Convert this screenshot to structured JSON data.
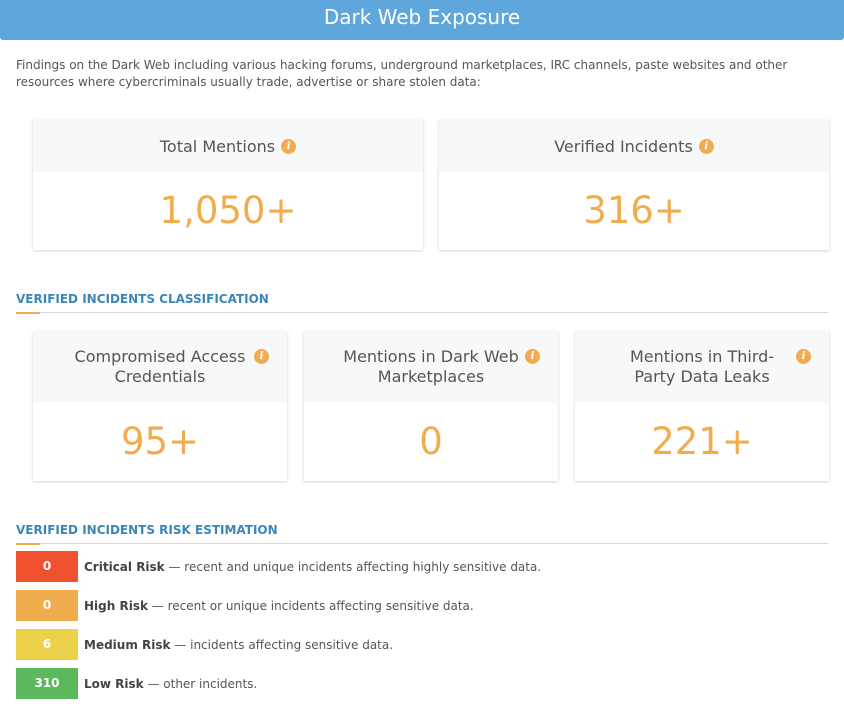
{
  "header": {
    "title": "Dark Web Exposure"
  },
  "intro": "Findings on the Dark Web including various hacking forums, underground marketplaces, IRC channels, paste websites and other resources where cybercriminals usually trade, advertise or share stolen data:",
  "top_cards": [
    {
      "label": "Total Mentions",
      "value": "1,050+"
    },
    {
      "label": "Verified Incidents",
      "value": "316+"
    }
  ],
  "classification": {
    "title": "VERIFIED INCIDENTS CLASSIFICATION",
    "cards": [
      {
        "label": "Compromised Access Credentials",
        "value": "95+"
      },
      {
        "label": "Mentions in Dark Web Marketplaces",
        "value": "0"
      },
      {
        "label": "Mentions in Third-Party Data Leaks",
        "value": "221+"
      }
    ]
  },
  "risk": {
    "title": "VERIFIED INCIDENTS RISK ESTIMATION",
    "rows": [
      {
        "count": "0",
        "label": "Critical Risk",
        "desc": " — recent and unique incidents affecting highly sensitive data.",
        "color": "#f0512e"
      },
      {
        "count": "0",
        "label": "High Risk",
        "desc": " — recent or unique incidents affecting sensitive data.",
        "color": "#f0ad4e"
      },
      {
        "count": "6",
        "label": "Medium Risk",
        "desc": " — incidents affecting sensitive data.",
        "color": "#ecd24a"
      },
      {
        "count": "310",
        "label": "Low Risk",
        "desc": " — other incidents.",
        "color": "#5cb85c"
      }
    ]
  },
  "icons": {
    "info": "info-icon"
  }
}
